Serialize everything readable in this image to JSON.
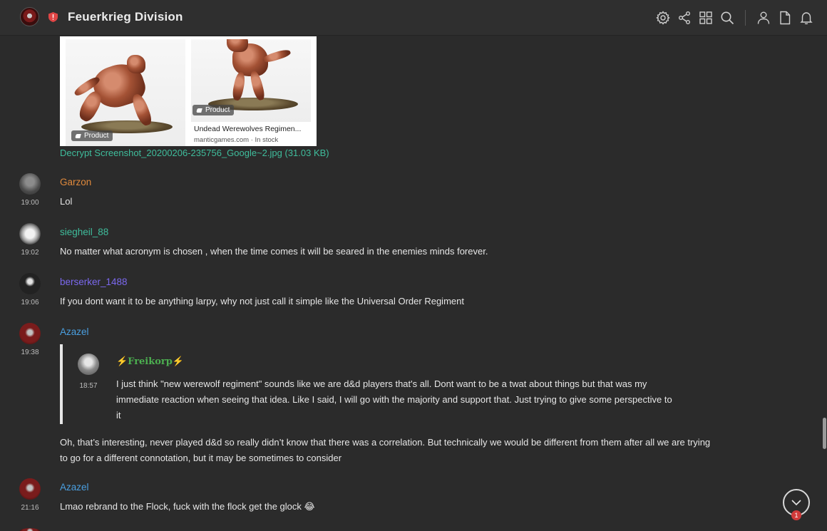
{
  "header": {
    "title": "Feuerkrieg Division",
    "icons": [
      "settings-icon",
      "share-icon",
      "apps-icon",
      "search-icon",
      "user-icon",
      "file-icon",
      "bell-icon"
    ]
  },
  "attachment": {
    "tag1": "Product",
    "tag2": "Product",
    "caption": "Undead Werewolves Regimen...",
    "source": "manticgames.com · In stock",
    "file_link": "Decrypt Screenshot_20200206-235756_Google~2.jpg (31.03 KB)"
  },
  "messages": [
    {
      "sender": "Garzon",
      "time": "19:00",
      "text": "Lol",
      "color": "#e08a3c"
    },
    {
      "sender": "siegheil_88",
      "time": "19:02",
      "text": "No matter what acronym is chosen , when the time comes it will be seared in the enemies minds forever.",
      "color": "#3fbd9c"
    },
    {
      "sender": "berserker_1488",
      "time": "19:06",
      "text": "If you dont want it to be anything larpy, why not just call it simple like the Universal Order Regiment",
      "color": "#7b68ee"
    },
    {
      "sender": "Azazel",
      "time": "19:38",
      "text": "Oh, that’s interesting, never played d&d so really didn’t know that there was a correlation. But technically we would be different from them after all we are trying to go for a different connotation, but it may be sometimes to consider",
      "color": "#4a9fe0"
    },
    {
      "sender": "Azazel",
      "time": "21:16",
      "text": "Lmao rebrand to the Flock, fuck with the flock get the glock 😂",
      "color": "#4a9fe0"
    }
  ],
  "reply": {
    "sender": "⚡Freikorp⚡",
    "time": "18:57",
    "text": "I just think \"new werewolf regiment\" sounds like we are d&d players that's all. Dont want to be a twat about things but that was my immediate reaction when seeing that idea. Like I said, I will go with the majority and support that. Just trying to give some perspective to it"
  },
  "unread_count": "1"
}
